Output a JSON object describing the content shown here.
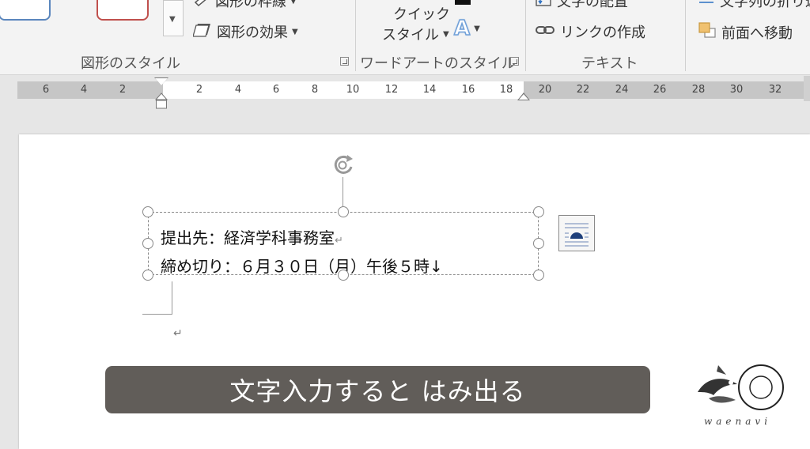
{
  "ribbon": {
    "shape_styles": {
      "outline_button": "図形の枠線",
      "effects_button": "図形の効果",
      "group_label": "図形のスタイル"
    },
    "wordart": {
      "quick_style_line1": "クイック",
      "quick_style_line2": "スタイル",
      "text_effects_glyph": "A",
      "group_label": "ワードアートのスタイル"
    },
    "text": {
      "align_text_button": "文字の配置",
      "create_link_button": "リンクの作成",
      "group_label": "テキスト"
    },
    "arrange": {
      "wrap_text_button": "文字列の折り返し",
      "bring_forward_button": "前面へ移動"
    }
  },
  "ruler": {
    "left_ticks": [
      "6",
      "4",
      "2"
    ],
    "right_ticks": [
      "2",
      "4",
      "6",
      "8",
      "10",
      "12",
      "14",
      "16",
      "18",
      "20",
      "22",
      "24",
      "26",
      "28",
      "30",
      "32"
    ]
  },
  "document": {
    "textbox": {
      "line1": "提出先：経済学科事務室",
      "line2": "締め切り：６月３０日（月）午後５時↓"
    },
    "paragraph_mark": "↵"
  },
  "caption": "文字入力すると はみ出る",
  "logo": {
    "text": "waenavi"
  },
  "colors": {
    "ribbon_bg": "#f3f3f3",
    "caption_bg": "#615d59",
    "preset_blue": "#5a86bd",
    "preset_red": "#c0504d",
    "text_effect_blue": "#6f9fd8"
  }
}
